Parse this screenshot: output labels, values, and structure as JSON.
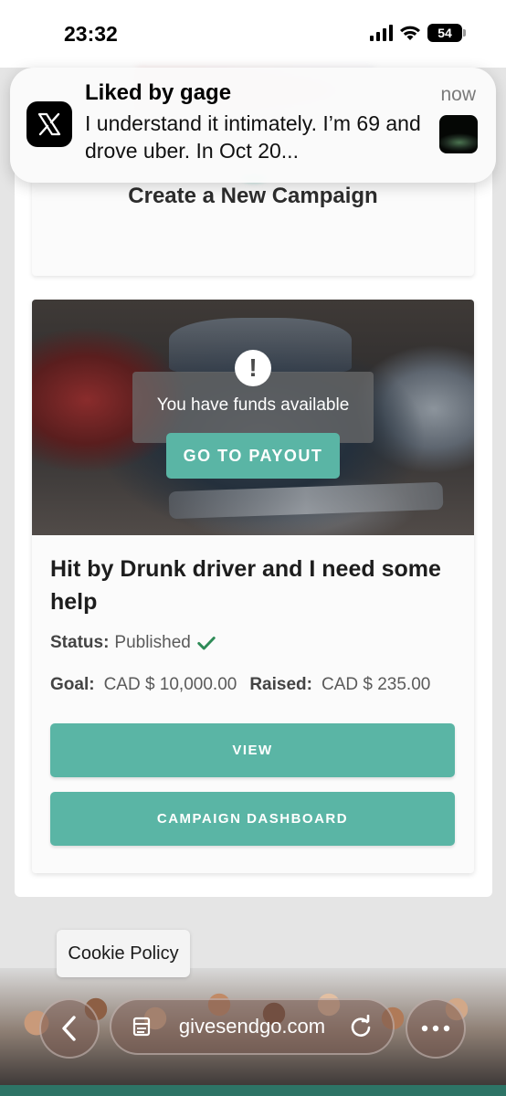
{
  "status_bar": {
    "time": "23:32",
    "battery": "54",
    "icons": [
      "signal-icon",
      "wifi-icon",
      "battery-icon"
    ]
  },
  "notification": {
    "app_icon": "x-logo-icon",
    "title": "Liked by gage",
    "time": "now",
    "body": "I understand it intimately. I’m 69 and drove uber. In Oct 20..."
  },
  "create_campaign": {
    "title": "Create a New Campaign"
  },
  "campaign": {
    "alert_icon": "exclamation-icon",
    "funds_message": "You have funds available",
    "payout_button": "GO TO PAYOUT",
    "title": "Hit by Drunk driver and I need some help",
    "status_label": "Status:",
    "status_value": "Published",
    "goal_label": "Goal:",
    "goal_value": "CAD $ 10,000.00",
    "raised_label": "Raised:",
    "raised_value": "CAD $ 235.00",
    "view_button": "VIEW",
    "dashboard_button": "CAMPAIGN DASHBOARD"
  },
  "cookie": {
    "label": "Cookie Policy"
  },
  "browser": {
    "url": "givesendgo.com",
    "back_icon": "chevron-left-icon",
    "tabs_icon": "tabs-icon",
    "reload_icon": "reload-icon",
    "more_icon": "more-dots-icon"
  },
  "colors": {
    "accent": "#5ab5a5",
    "check": "#2e8b57",
    "bottom_strip": "#2d7466"
  }
}
